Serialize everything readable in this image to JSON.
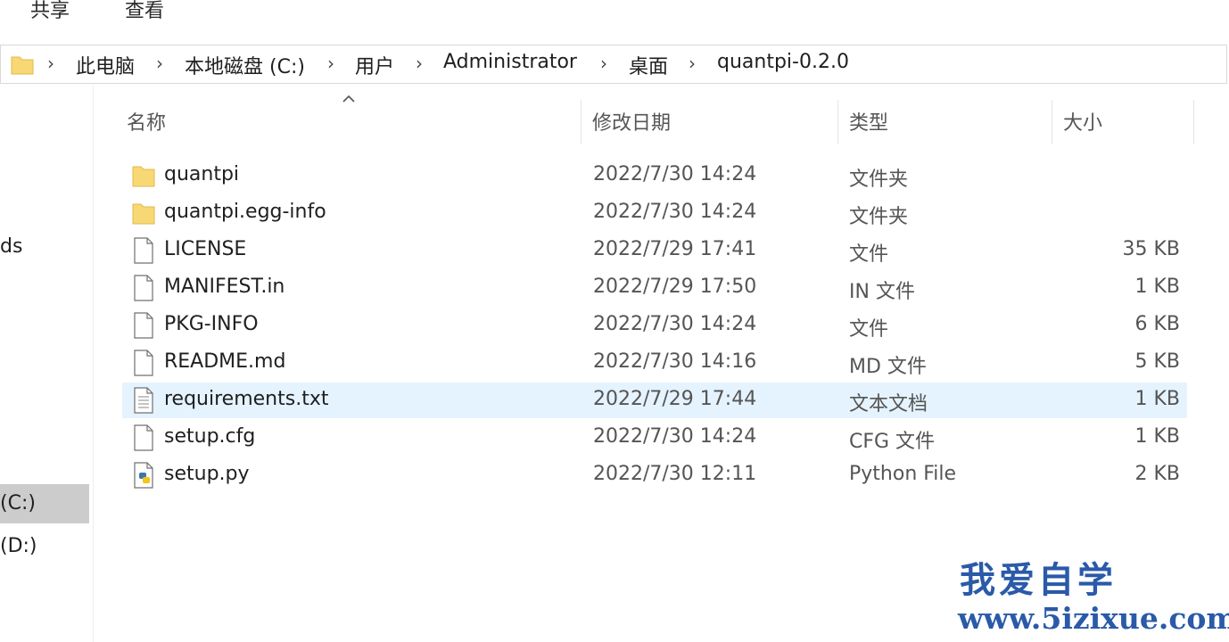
{
  "ribbon": {
    "tabs": [
      "共享",
      "查看"
    ]
  },
  "address_bar": {
    "crumbs": [
      "此电脑",
      "本地磁盘 (C:)",
      "用户",
      "Administrator",
      "桌面",
      "quantpi-0.2.0"
    ]
  },
  "nav": {
    "items": [
      "ds",
      "(C:)",
      "(D:)"
    ]
  },
  "columns": {
    "name": "名称",
    "date": "修改日期",
    "type": "类型",
    "size": "大小"
  },
  "files": [
    {
      "icon": "folder-icon",
      "name": "quantpi",
      "date": "2022/7/30 14:24",
      "type": "文件夹",
      "size": ""
    },
    {
      "icon": "folder-icon",
      "name": "quantpi.egg-info",
      "date": "2022/7/30 14:24",
      "type": "文件夹",
      "size": ""
    },
    {
      "icon": "file-icon",
      "name": "LICENSE",
      "date": "2022/7/29 17:41",
      "type": "文件",
      "size": "35 KB"
    },
    {
      "icon": "file-icon",
      "name": "MANIFEST.in",
      "date": "2022/7/29 17:50",
      "type": "IN 文件",
      "size": "1 KB"
    },
    {
      "icon": "file-icon",
      "name": "PKG-INFO",
      "date": "2022/7/30 14:24",
      "type": "文件",
      "size": "6 KB"
    },
    {
      "icon": "file-icon",
      "name": "README.md",
      "date": "2022/7/30 14:16",
      "type": "MD 文件",
      "size": "5 KB"
    },
    {
      "icon": "text-file-icon",
      "name": "requirements.txt",
      "date": "2022/7/29 17:44",
      "type": "文本文档",
      "size": "1 KB"
    },
    {
      "icon": "file-icon",
      "name": "setup.cfg",
      "date": "2022/7/30 14:24",
      "type": "CFG 文件",
      "size": "1 KB"
    },
    {
      "icon": "python-file-icon",
      "name": "setup.py",
      "date": "2022/7/30 12:11",
      "type": "Python File",
      "size": "2 KB"
    }
  ],
  "watermark": {
    "title": "我爱自学",
    "url": "www.5izixue.com"
  },
  "colors": {
    "folder": "#f8d775",
    "selected_row": "#e5f3ff",
    "selected_nav": "#cccccc",
    "watermark": "#2a5aa8"
  }
}
